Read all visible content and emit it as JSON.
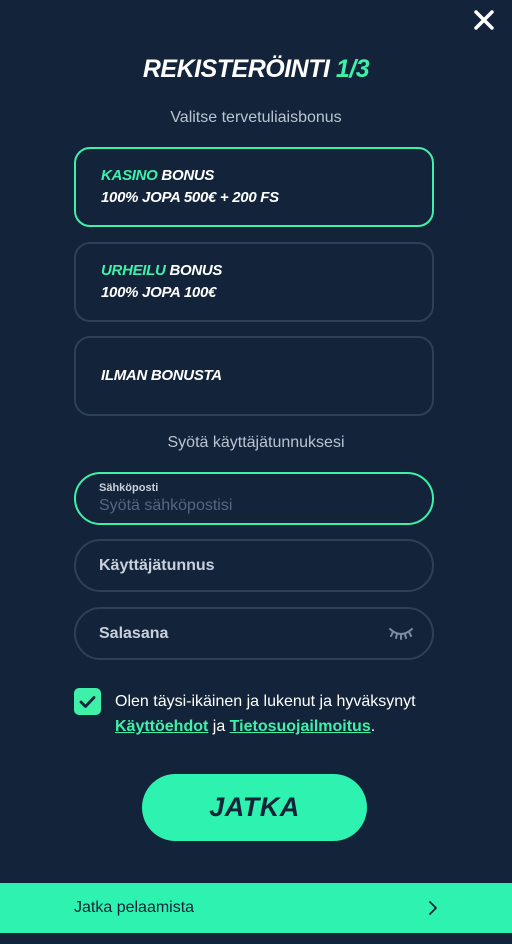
{
  "header": {
    "close_icon": "close-icon",
    "title": "REKISTERÖINTI",
    "step": "1/3"
  },
  "bonus_section": {
    "heading": "Valitse tervetuliaisbonus",
    "options": [
      {
        "accent": "KASINO",
        "label": " BONUS",
        "detail": "100% JOPA 500€ + 200 FS",
        "selected": true
      },
      {
        "accent": "URHEILU",
        "label": " BONUS",
        "detail": "100% JOPA 100€",
        "selected": false
      },
      {
        "accent": "",
        "label": "ILMAN BONUSTA",
        "detail": "",
        "selected": false
      }
    ]
  },
  "credentials_section": {
    "heading": "Syötä käyttäjätunnuksesi",
    "email": {
      "label": "Sähköposti",
      "placeholder": "Syötä sähköpostisi",
      "value": ""
    },
    "username": {
      "label": "Käyttäjätunnus"
    },
    "password": {
      "label": "Salasana",
      "toggle_icon": "eye-closed-icon"
    }
  },
  "terms": {
    "checked": true,
    "text_before": "Olen täysi-ikäinen ja lukenut ja hyväksynyt ",
    "link1": "Käyttöehdot",
    "text_middle": " ja ",
    "link2": "Tietosuojailmoitus",
    "text_after": "."
  },
  "actions": {
    "continue_label": "JATKA"
  },
  "footer": {
    "label": "Jatka pelaamista",
    "icon": "chevron-right-icon"
  },
  "colors": {
    "background": "#13243a",
    "accent": "#3ff0a8",
    "border": "#2c405a"
  }
}
